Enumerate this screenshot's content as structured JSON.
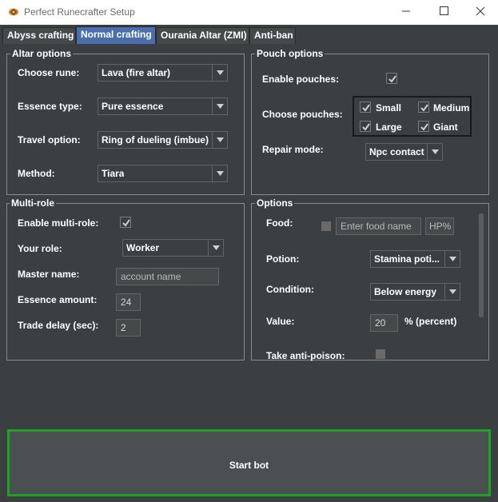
{
  "window": {
    "title": "Perfect Runecrafter Setup",
    "minimize_icon": "minimize-icon",
    "maximize_icon": "maximize-icon",
    "close_icon": "close-icon"
  },
  "tabs": [
    {
      "label": "Abyss crafting"
    },
    {
      "label": "Normal crafting",
      "active": true
    },
    {
      "label": "Ourania Altar (ZMI)"
    },
    {
      "label": "Anti-ban"
    }
  ],
  "altar_options": {
    "title": "Altar options",
    "choose_rune_label": "Choose rune:",
    "choose_rune_value": "Lava (fire altar)",
    "essence_type_label": "Essence type:",
    "essence_type_value": "Pure essence",
    "travel_option_label": "Travel option:",
    "travel_option_value": "Ring of dueling (imbue)",
    "method_label": "Method:",
    "method_value": "Tiara"
  },
  "pouch_options": {
    "title": "Pouch options",
    "enable_pouches_label": "Enable pouches:",
    "enable_pouches_checked": true,
    "choose_pouches_label": "Choose pouches:",
    "pouches": [
      {
        "label": "Small",
        "checked": true
      },
      {
        "label": "Medium",
        "checked": true
      },
      {
        "label": "Large",
        "checked": true
      },
      {
        "label": "Giant",
        "checked": true
      }
    ],
    "repair_mode_label": "Repair mode:",
    "repair_mode_value": "Npc contact"
  },
  "multi_role": {
    "title": "Multi-role",
    "enable_label": "Enable multi-role:",
    "enable_checked": true,
    "your_role_label": "Your role:",
    "your_role_value": "Worker",
    "master_name_label": "Master name:",
    "master_name_placeholder": "account name",
    "essence_amount_label": "Essence amount:",
    "essence_amount_value": "24",
    "trade_delay_label": "Trade delay (sec):",
    "trade_delay_value": "2"
  },
  "options": {
    "title": "Options",
    "food_label": "Food:",
    "food_checked": false,
    "food_placeholder": "Enter food name",
    "hp_placeholder": "HP%",
    "potion_label": "Potion:",
    "potion_value": "Stamina poti...",
    "condition_label": "Condition:",
    "condition_value": "Below energy",
    "value_label": "Value:",
    "value_value": "20",
    "value_unit": "% (percent)",
    "anti_poison_label": "Take anti-poison:",
    "anti_poison_checked": false
  },
  "start_button": {
    "label": "Start bot"
  },
  "colors": {
    "background": "#3c3f41",
    "active_tab": "#4b6eaf",
    "start_border": "#1aa61a"
  }
}
